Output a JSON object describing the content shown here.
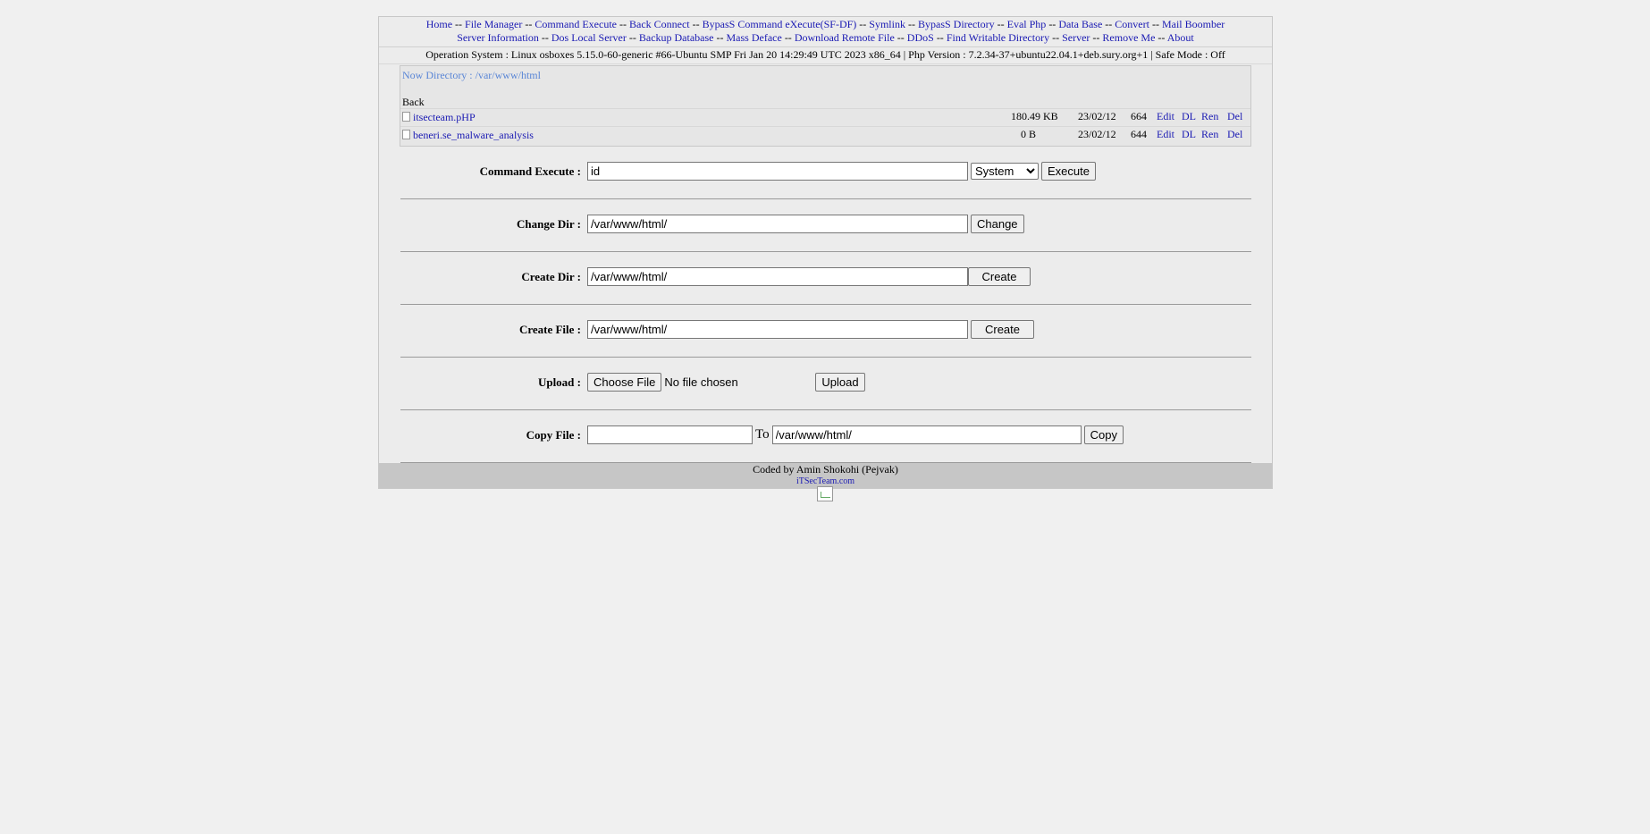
{
  "nav": {
    "row1": [
      "Home",
      "File Manager",
      "Command Execute",
      "Back Connect",
      "BypasS Command eXecute(SF-DF)",
      "Symlink",
      "BypasS Directory",
      "Eval Php",
      "Data Base",
      "Convert",
      "Mail Boomber"
    ],
    "row2": [
      "Server Information",
      "Dos Local Server",
      "Backup Database",
      "Mass Deface",
      "Download Remote File",
      "DDoS",
      "Find Writable Directory",
      "Server",
      "Remove Me",
      "About"
    ],
    "separator": "--"
  },
  "os_info": "Operation System : Linux osboxes 5.15.0-60-generic #66-Ubuntu SMP Fri Jan 20 14:29:49 UTC 2023 x86_64 | Php Version : 7.2.34-37+ubuntu22.04.1+deb.sury.org+1 | Safe Mode : Off",
  "files": {
    "now_directory": "Now Directory : /var/www/html",
    "back": "Back",
    "items": [
      {
        "name": "itsecteam.pHP",
        "size": "180.49 KB",
        "date": "23/02/12",
        "perm": "664",
        "edit": "Edit",
        "dl": "DL",
        "ren": "Ren",
        "del": "Del"
      },
      {
        "name": "beneri.se_malware_analysis",
        "size": "0 B",
        "date": "23/02/12",
        "perm": "644",
        "edit": "Edit",
        "dl": "DL",
        "ren": "Ren",
        "del": "Del"
      }
    ]
  },
  "forms": {
    "command": {
      "label": "Command Execute :",
      "value": "id",
      "select": "System",
      "button": "Execute"
    },
    "change_dir": {
      "label": "Change Dir :",
      "value": "/var/www/html/",
      "button": "Change"
    },
    "create_dir": {
      "label": "Create Dir :",
      "value": "/var/www/html/",
      "button": "Create"
    },
    "create_file": {
      "label": "Create File :",
      "value": "/var/www/html/",
      "button": "Create"
    },
    "upload": {
      "label": "Upload :",
      "choose": "Choose File",
      "status": "No file chosen",
      "button": "Upload"
    },
    "copy": {
      "label": "Copy File :",
      "from": "",
      "to_label": "To",
      "to": "/var/www/html/",
      "button": "Copy"
    }
  },
  "footer": {
    "credit": "Coded by Amin Shokohi (Pejvak)",
    "site": "iTSecTeam.com"
  }
}
